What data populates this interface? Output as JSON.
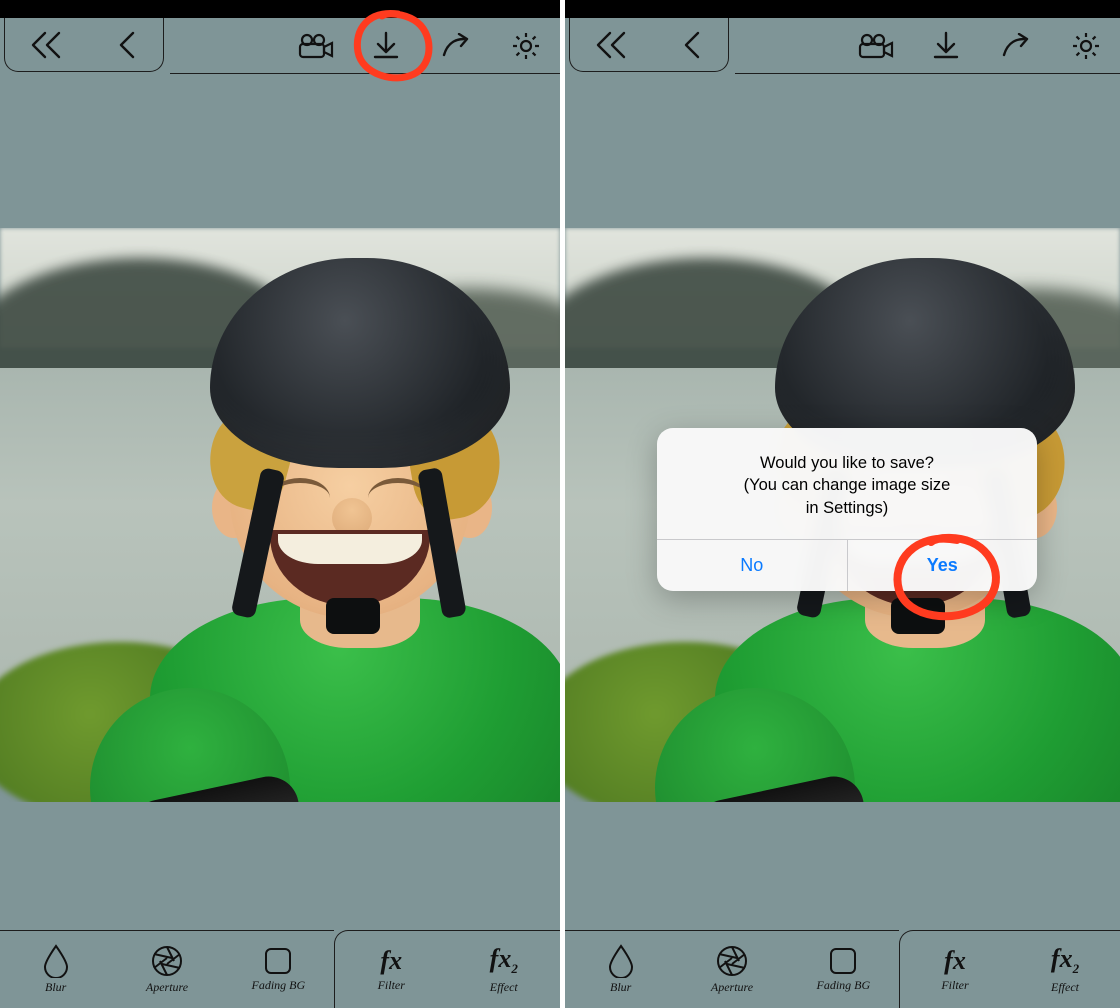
{
  "annotation": {
    "color": "#ff3b1f",
    "left_target": "download-button",
    "right_target": "dialog-yes-button"
  },
  "toolbar_top": {
    "icons": {
      "back_all": "double-chevron-left",
      "back": "chevron-left",
      "video": "video-camera",
      "download": "download",
      "share": "share-arrow",
      "settings": "gear"
    }
  },
  "toolbar_bottom": {
    "items": [
      {
        "icon": "drop",
        "label": "Blur"
      },
      {
        "icon": "aperture",
        "label": "Aperture"
      },
      {
        "icon": "square",
        "label": "Fading BG"
      },
      {
        "icon": "fx",
        "label": "Filter"
      },
      {
        "icon": "fx2",
        "label": "Effect"
      }
    ]
  },
  "dialog": {
    "line1": "Would you like to save?",
    "line2": "(You can change image size",
    "line3": "in Settings)",
    "no_label": "No",
    "yes_label": "Yes"
  },
  "colors": {
    "app_bg": "#7f9597",
    "ios_blue": "#0a7aff",
    "annotation_red": "#ff3b1f"
  }
}
